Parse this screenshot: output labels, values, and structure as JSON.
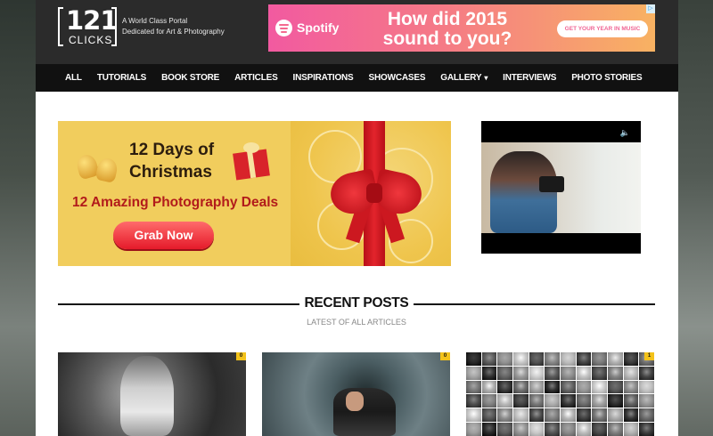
{
  "site": {
    "logo_number": "121",
    "logo_word": "CLICKS",
    "tagline_line1": "A World Class Portal",
    "tagline_line2": "Dedicated for Art & Photography"
  },
  "top_ad": {
    "brand": "Spotify",
    "headline_line1": "How did 2015",
    "headline_line2": "sound to you?",
    "cta": "GET YOUR YEAR IN MUSIC",
    "adchoices": "▷"
  },
  "nav": {
    "items": [
      {
        "label": "ALL"
      },
      {
        "label": "TUTORIALS"
      },
      {
        "label": "BOOK STORE"
      },
      {
        "label": "ARTICLES"
      },
      {
        "label": "INSPIRATIONS"
      },
      {
        "label": "SHOWCASES"
      },
      {
        "label": "GALLERY",
        "dropdown": true
      },
      {
        "label": "INTERVIEWS"
      },
      {
        "label": "PHOTO STORIES"
      }
    ],
    "chevron_icon": "chevron-down-icon"
  },
  "banner": {
    "title_line1": "12 Days of",
    "title_line2": "Christmas",
    "subtitle": "12 Amazing Photography Deals",
    "button": "Grab Now",
    "colors": {
      "background": "#f1cd5d",
      "ribbon": "#d8232a",
      "subtitle": "#b21b1b"
    }
  },
  "video": {
    "volume_icon": "speaker-icon",
    "volume_glyph": "🔈"
  },
  "recent": {
    "title": "RECENT POSTS",
    "subtitle": "LATEST OF ALL ARTICLES"
  },
  "posts": [
    {
      "comments": "0"
    },
    {
      "comments": "0"
    },
    {
      "comments": "1"
    }
  ],
  "colors": {
    "header_bg": "#2b2b2b",
    "nav_bg": "#111111",
    "badge": "#f3c21a"
  }
}
